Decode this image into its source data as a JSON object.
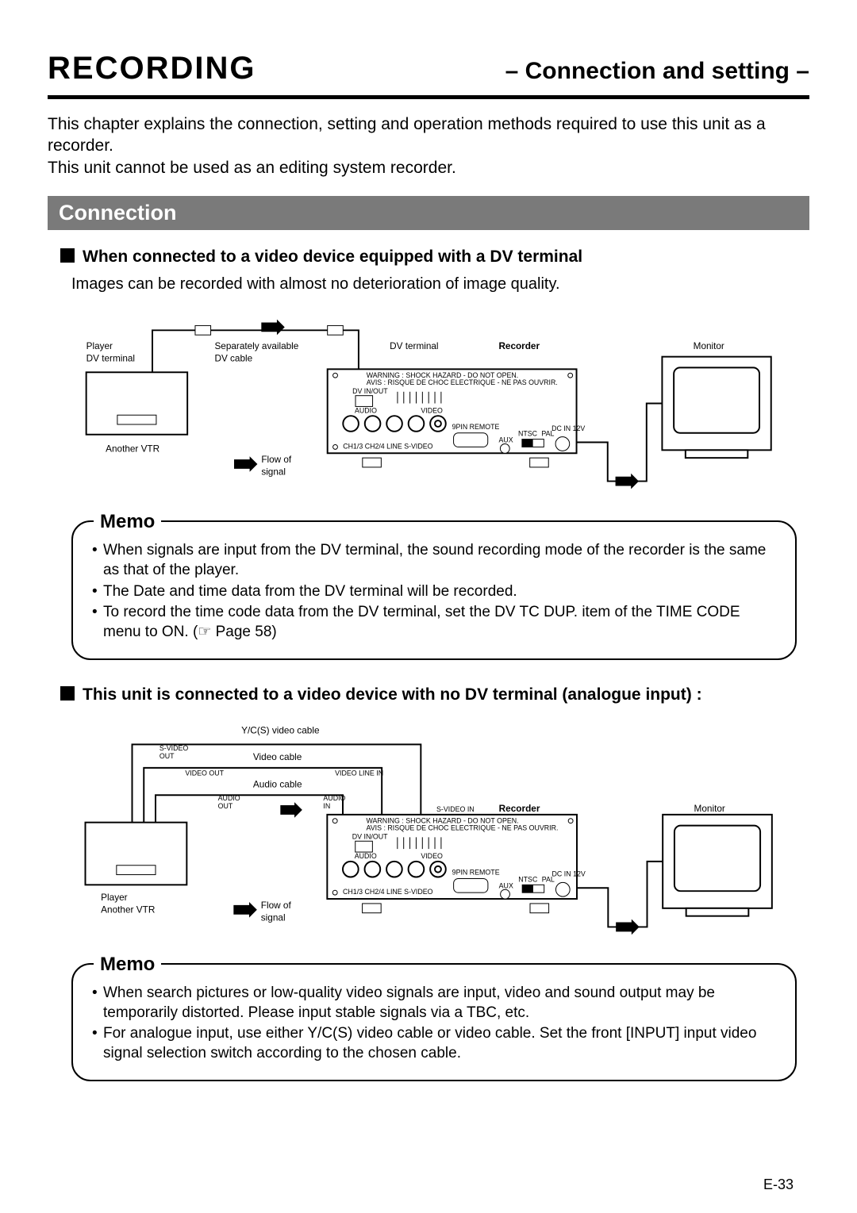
{
  "header": {
    "main": "RECORDING",
    "sub": "– Connection and setting –"
  },
  "intro": {
    "p1": "This chapter explains the connection, setting and operation methods required to use this unit as a recorder.",
    "p2": "This unit cannot be used as an editing system recorder."
  },
  "section_bar": "Connection",
  "sec1": {
    "heading": "When connected to a video device equipped with a DV terminal",
    "body": "Images can be recorded with almost no deterioration of image quality."
  },
  "fig1": {
    "player_label": "Player",
    "player_terminal": "DV terminal",
    "another_vtr": "Another VTR",
    "dv_cable_top": "Separately available",
    "dv_cable_bottom": "DV cable",
    "flow_top": "Flow of",
    "flow_bottom": "signal",
    "dv_terminal": "DV terminal",
    "recorder": "Recorder",
    "monitor": "Monitor",
    "panel": {
      "warning": "WARNING : SHOCK HAZARD - DO NOT OPEN.",
      "avis": "AVIS : RISQUE DE CHOC ELECTRIQUE - NE PAS OUVRIR.",
      "dv": "DV IN/OUT",
      "audio": "AUDIO",
      "video": "VIDEO",
      "rowlabels": "CH1/3   CH2/4   LINE   S-VIDEO",
      "remote": "9PIN REMOTE",
      "aux": "AUX",
      "ntsc": "NTSC",
      "pal": "PAL",
      "dcin": "DC IN 12V"
    }
  },
  "memo1": {
    "title": "Memo",
    "items": [
      "When signals are input from the DV terminal, the sound recording mode of the recorder is the same as that of the player.",
      "The Date and time data from the DV terminal will be recorded.",
      "To record the time code data from the DV terminal, set the DV TC DUP. item of the TIME CODE menu to ON. (☞ Page 58)"
    ]
  },
  "sec2": {
    "heading": "This unit is connected to a video device with no DV terminal (analogue input) :"
  },
  "fig2": {
    "yc_cable": "Y/C(S) video cable",
    "s_video_out": "S-VIDEO OUT",
    "video_cable": "Video cable",
    "video_out": "VIDEO OUT",
    "video_line_in": "VIDEO LINE IN",
    "audio_cable": "Audio cable",
    "audio_out": "AUDIO OUT",
    "audio_in": "AUDIO IN",
    "s_video_in": "S-VIDEO IN",
    "recorder": "Recorder",
    "monitor": "Monitor",
    "player": "Player",
    "another_vtr": "Another VTR",
    "flow_top": "Flow of",
    "flow_bottom": "signal",
    "panel": {
      "warning": "WARNING : SHOCK HAZARD - DO NOT OPEN.",
      "avis": "AVIS : RISQUE DE CHOC ELECTRIQUE - NE PAS OUVRIR.",
      "dv": "DV IN/OUT",
      "audio": "AUDIO",
      "video": "VIDEO",
      "rowlabels": "CH1/3   CH2/4   LINE   S-VIDEO",
      "remote": "9PIN REMOTE",
      "aux": "AUX",
      "ntsc": "NTSC",
      "pal": "PAL",
      "dcin": "DC IN 12V"
    }
  },
  "memo2": {
    "title": "Memo",
    "items": [
      "When search pictures or low-quality video signals are input, video and sound output may be temporarily distorted. Please input stable signals via a TBC, etc.",
      "For analogue input, use either Y/C(S) video cable or video cable. Set the front [INPUT] input video signal selection switch according to the chosen cable."
    ]
  },
  "page_number": "E-33"
}
